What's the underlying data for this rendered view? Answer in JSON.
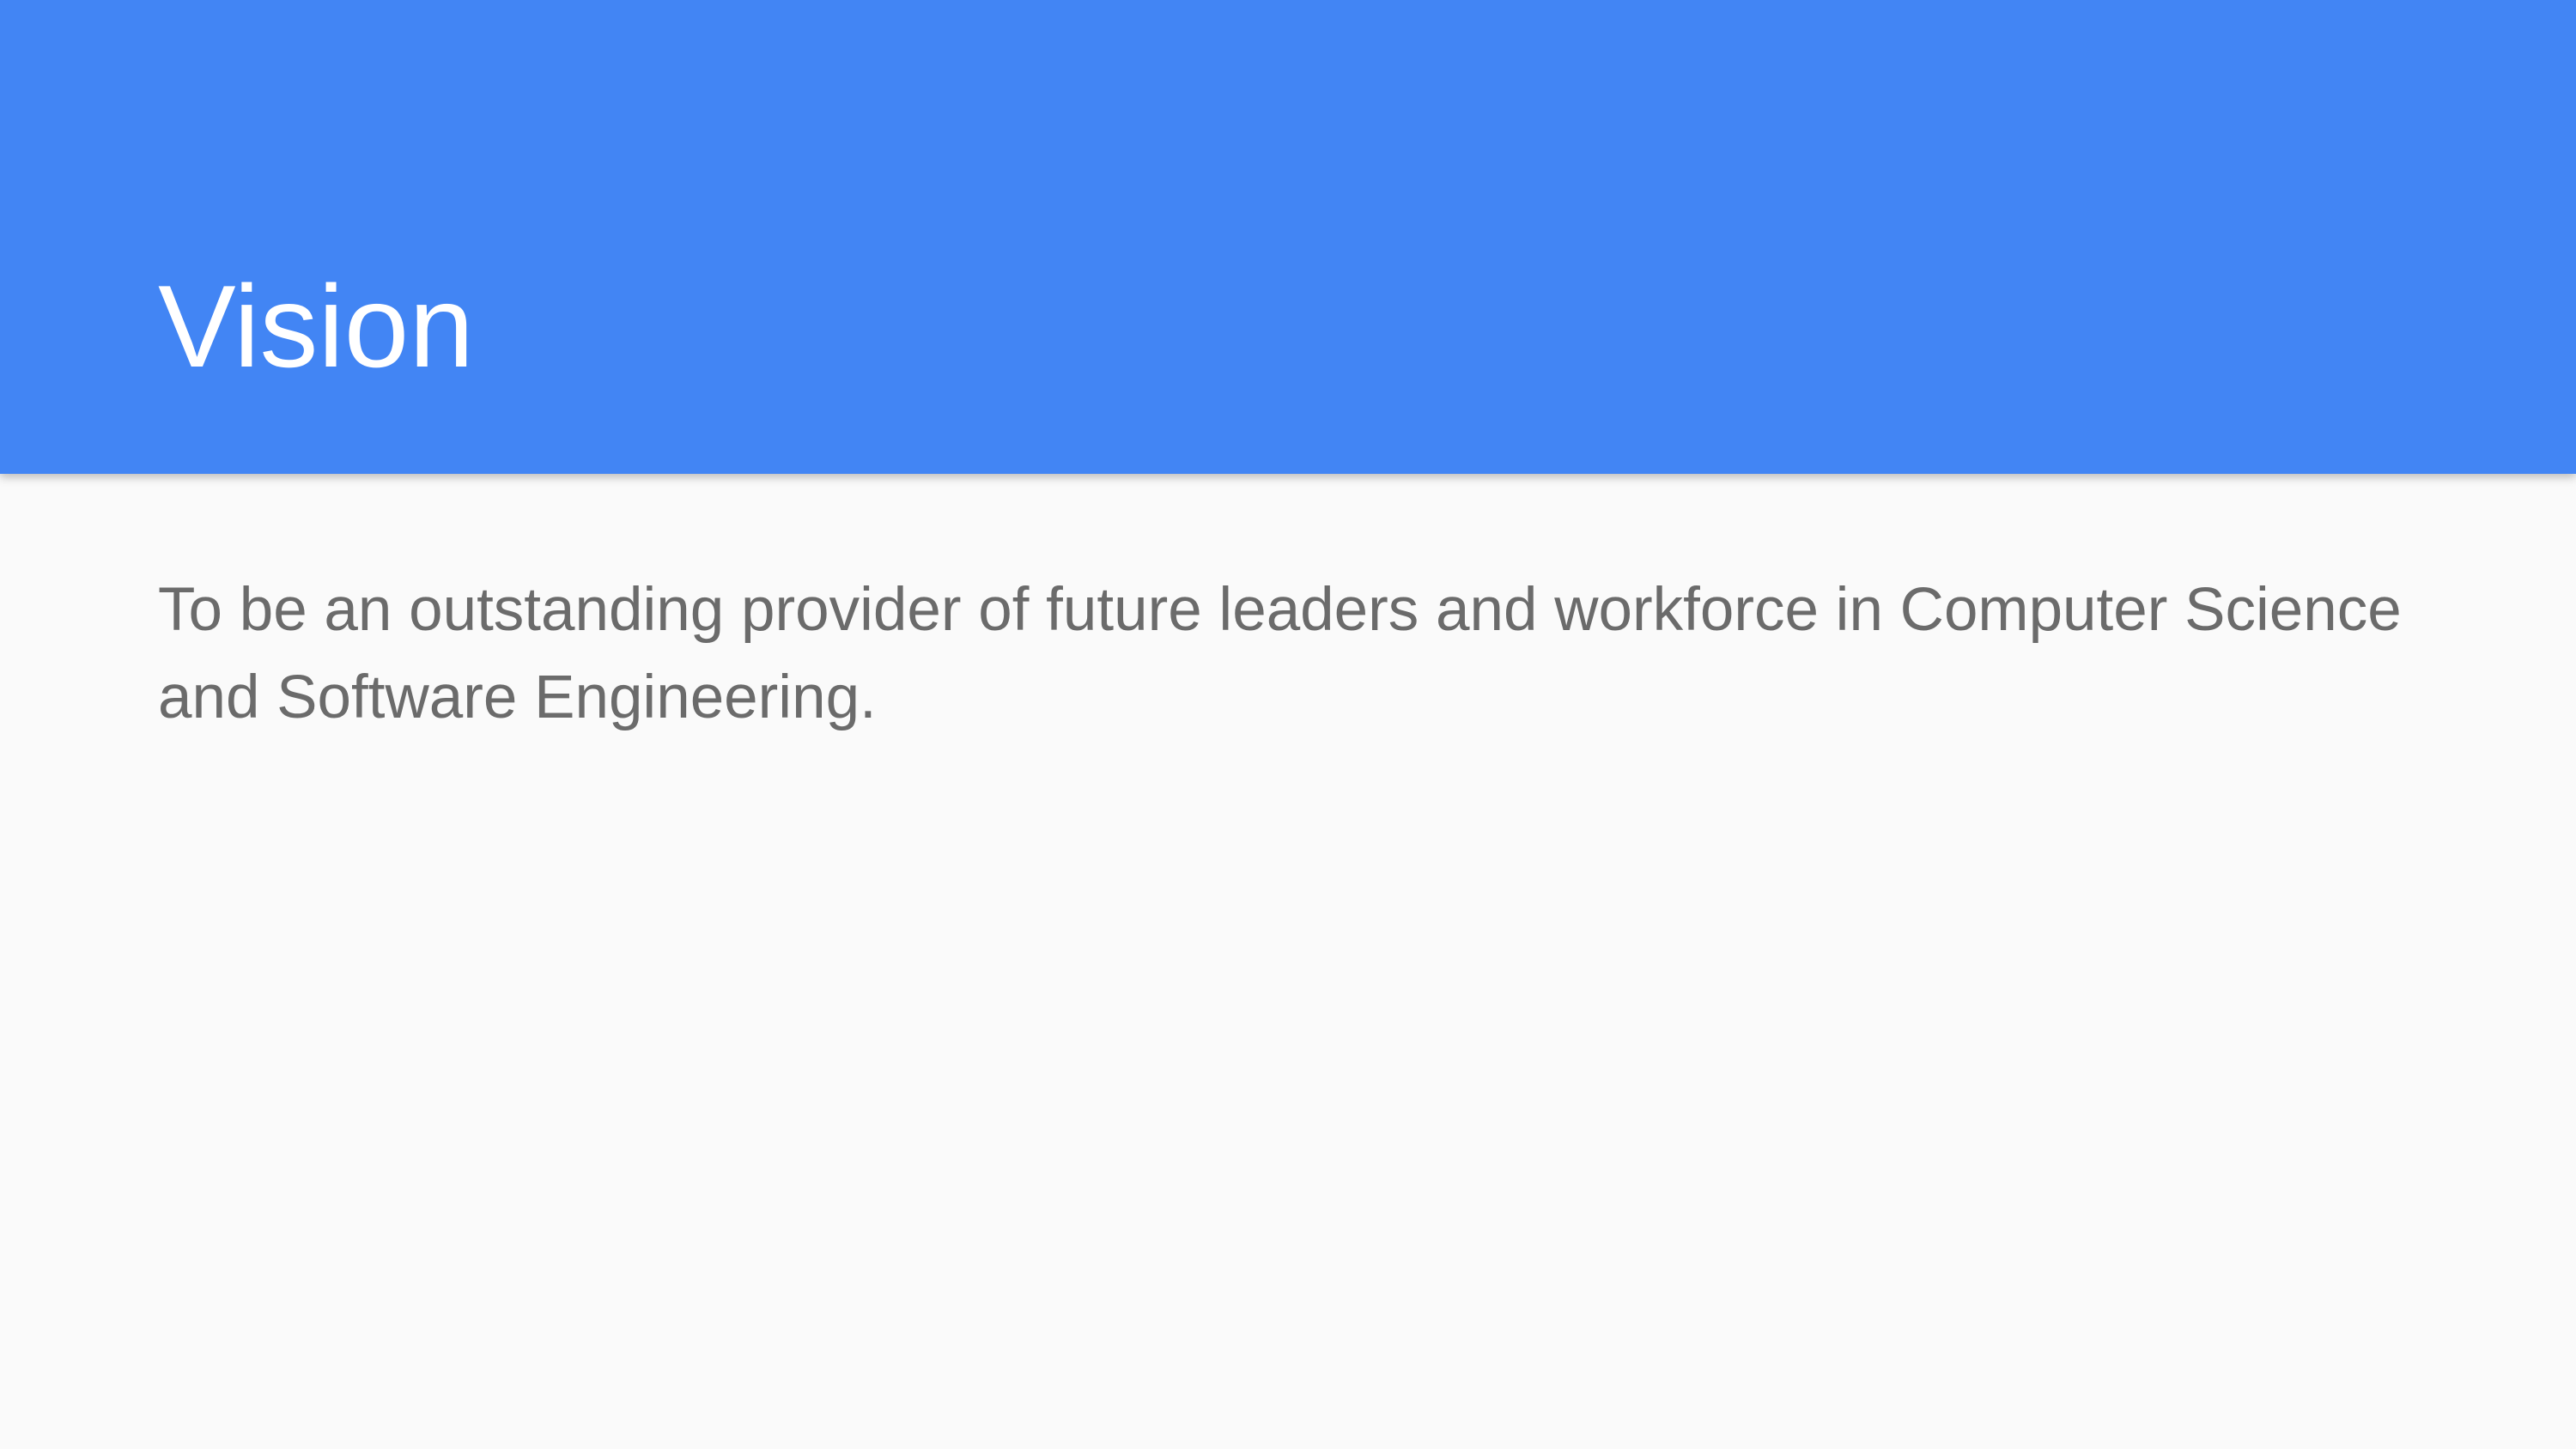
{
  "slide": {
    "title": "Vision",
    "body": "To be an outstanding provider of future leaders and workforce in Computer Science and Software Engineering.",
    "colors": {
      "header_background": "#4285f4",
      "title_text": "#ffffff",
      "body_text": "#6b6b6b",
      "page_background": "#fafafa"
    }
  }
}
